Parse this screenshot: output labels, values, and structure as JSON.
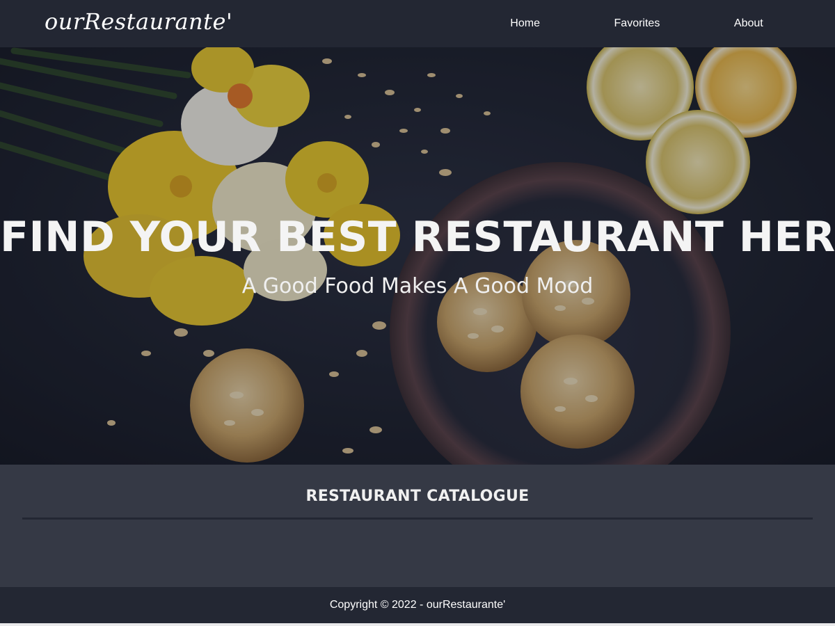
{
  "nav": {
    "brand": "ourRestaurante'",
    "items": [
      {
        "label": "Home"
      },
      {
        "label": "Favorites"
      },
      {
        "label": "About"
      }
    ]
  },
  "hero": {
    "title": "FIND YOUR BEST RESTAURANT HERE",
    "subtitle": "A Good Food Makes A Good Mood"
  },
  "catalogue": {
    "title": "RESTAURANT CATALOGUE"
  },
  "footer": {
    "text": "Copyright © 2022 - ourRestaurante'"
  },
  "colors": {
    "navbar": "#232733",
    "page_background": "#353945",
    "footer": "#232733",
    "text": "#ffffff"
  }
}
